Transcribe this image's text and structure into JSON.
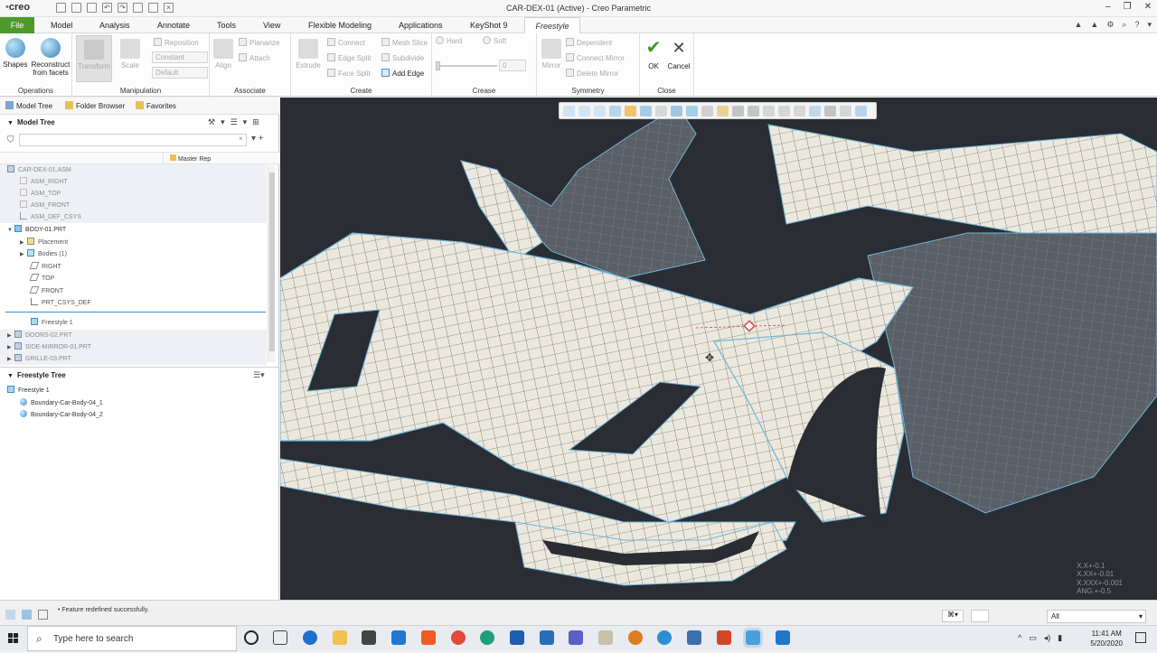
{
  "titlebar": {
    "app_logo": "creo",
    "window_title": "CAR-DEX-01 (Active) - Creo Parametric"
  },
  "tabs": [
    {
      "label": "File"
    },
    {
      "label": "Model"
    },
    {
      "label": "Analysis"
    },
    {
      "label": "Annotate"
    },
    {
      "label": "Tools"
    },
    {
      "label": "View"
    },
    {
      "label": "Flexible Modeling"
    },
    {
      "label": "Applications"
    },
    {
      "label": "KeyShot 9"
    },
    {
      "label": "Freestyle"
    }
  ],
  "ribbon": {
    "operations": {
      "shapes": "Shapes",
      "reconstruct": "Reconstruct from facets",
      "label": "Operations"
    },
    "manipulation": {
      "transform": "Transform",
      "scale": "Scale",
      "reposition": "Reposition",
      "combo1": "Constant",
      "combo2": "Default",
      "label": "Manipulation"
    },
    "associate": {
      "align": "Align",
      "planarize": "Planarize",
      "attach": "Attach",
      "label": "Associate"
    },
    "create": {
      "extrude": "Extrude",
      "connect": "Connect",
      "edge_split": "Edge Split",
      "face_split": "Face Split",
      "mesh_slice": "Mesh Slice",
      "subdivide": "Subdivide",
      "add_edge": "Add Edge",
      "label": "Create"
    },
    "crease": {
      "hard": "Hard",
      "soft": "Soft",
      "value": "0",
      "label": "Crease"
    },
    "symmetry": {
      "mirror": "Mirror",
      "dependent": "Dependent",
      "connect_mirror": "Connect Mirror",
      "delete_mirror": "Delete Mirror",
      "label": "Symmetry"
    },
    "close": {
      "ok": "OK",
      "cancel": "Cancel",
      "label": "Close"
    }
  },
  "navigator": {
    "tabs": [
      "Model Tree",
      "Folder Browser",
      "Favorites"
    ],
    "model_tree_title": "Model Tree",
    "master_rep": "Master Rep",
    "tree": [
      {
        "label": "CAR-DEX-01.ASM",
        "level": 0,
        "grey": true
      },
      {
        "label": "ASM_RIGHT",
        "level": 1,
        "grey": true
      },
      {
        "label": "ASM_TOP",
        "level": 1,
        "grey": true
      },
      {
        "label": "ASM_FRONT",
        "level": 1,
        "grey": true
      },
      {
        "label": "ASM_DEF_CSYS",
        "level": 1,
        "grey": true
      },
      {
        "label": "BODY-01.PRT",
        "level": 1,
        "grey": false
      },
      {
        "label": "Placement",
        "level": 2,
        "grey": false
      },
      {
        "label": "Bodies (1)",
        "level": 2,
        "grey": false
      },
      {
        "label": "RIGHT",
        "level": 2,
        "grey": false
      },
      {
        "label": "TOP",
        "level": 2,
        "grey": false
      },
      {
        "label": "FRONT",
        "level": 2,
        "grey": false
      },
      {
        "label": "PRT_CSYS_DEF",
        "level": 2,
        "grey": false
      },
      {
        "label": "Freestyle 1",
        "level": 2,
        "grey": false
      },
      {
        "label": "DOORS-02.PRT",
        "level": 1,
        "grey": true
      },
      {
        "label": "SIDE-MIRROR-01.PRT",
        "level": 1,
        "grey": true
      },
      {
        "label": "GRILLE-03.PRT",
        "level": 1,
        "grey": true
      }
    ],
    "freestyle_tree_title": "Freestyle Tree",
    "freestyle_tree": [
      {
        "label": "Freestyle 1"
      },
      {
        "label": "Boundary-Car-Body-04_1"
      },
      {
        "label": "Boundary-Car-Body-04_2"
      }
    ]
  },
  "viewport": {
    "tolerances": [
      "X.X+-0.1",
      "X.XX+-0.01",
      "X.XXX+-0.001",
      "ANG.+-0.5"
    ]
  },
  "statusbar": {
    "message": "• Feature redefined successfully.",
    "filter_value": "All"
  },
  "taskbar": {
    "search_placeholder": "Type here to search",
    "time": "11:41 AM",
    "date": "5/20/2020"
  },
  "colors": {
    "file_tab": "#4d9a2a",
    "viewport_bg": "#2a2d33",
    "mesh_surface": "#eeeae0",
    "mesh_edge": "#6fb6d8"
  }
}
